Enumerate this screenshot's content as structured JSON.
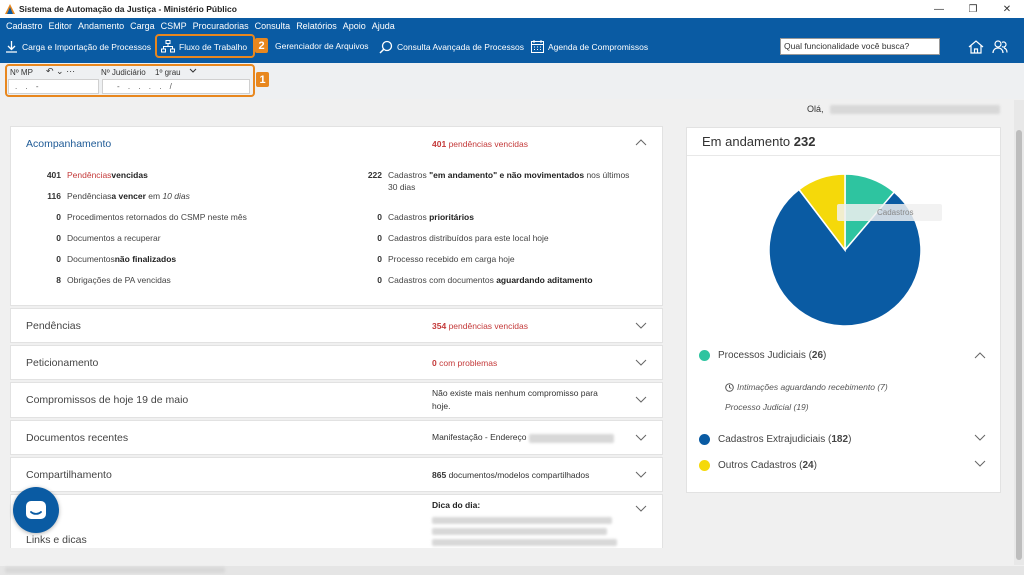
{
  "window": {
    "title": "Sistema de Automação da Justiça - Ministério Público"
  },
  "menu": [
    "Cadastro",
    "Editor",
    "Andamento",
    "Carga",
    "CSMP",
    "Procuradorias",
    "Consulta",
    "Relatórios",
    "Apoio",
    "Ajuda"
  ],
  "toolbar": {
    "carga": "Carga e Importação de Processos",
    "fluxo": "Fluxo de Trabalho",
    "gerenciador": "Gerenciador de Arquivos",
    "consulta": "Consulta Avançada de Processos",
    "agenda": "Agenda de Compromissos",
    "search_placeholder": "Qual funcionalidade você busca?"
  },
  "badges": {
    "one": "1",
    "two": "2"
  },
  "process": {
    "mp_label": "Nº MP",
    "undo_label": "↶ ⌄ ···",
    "jud_label": "Nº Judiciário",
    "grau": "1º grau",
    "mp_value": ".  .  -",
    "jud_value": "- .  .  .  . /"
  },
  "greeting": "Olá,",
  "acompanhamento": {
    "title": "Acompanhamento",
    "status_count": "401",
    "status_text": "pendências vencidas",
    "left": [
      {
        "n": "401",
        "a": "Pendências ",
        "b": "vencidas",
        "c": ""
      },
      {
        "n": "116",
        "a": "Pendências ",
        "b": "a vencer",
        "c": " em ",
        "d": "10 dias"
      },
      {
        "n": "0",
        "a": "Procedimentos retornados do CSMP neste mês",
        "b": "",
        "c": ""
      },
      {
        "n": "0",
        "a": "Documentos a recuperar",
        "b": "",
        "c": ""
      },
      {
        "n": "0",
        "a": "Documentos ",
        "b": "não finalizados",
        "c": ""
      },
      {
        "n": "8",
        "a": "Obrigações de PA vencidas",
        "b": "",
        "c": ""
      }
    ],
    "right": [
      {
        "n": "222",
        "a": "Cadastros ",
        "b": "\"em andamento\" e não movimentados",
        "c": " nos últimos",
        "d": "30 dias"
      },
      {
        "n": "0",
        "a": "Cadastros ",
        "b": "prioritários",
        "c": ""
      },
      {
        "n": "0",
        "a": "Cadastros distribuídos para este local hoje",
        "b": "",
        "c": ""
      },
      {
        "n": "0",
        "a": "Processo recebido em carga hoje",
        "b": "",
        "c": ""
      },
      {
        "n": "0",
        "a": "Cadastros com documentos ",
        "b": "aguardando aditamento",
        "c": ""
      }
    ]
  },
  "sections": [
    {
      "title": "Pendências",
      "count": "354",
      "status": "pendências vencidas",
      "status2": ""
    },
    {
      "title": "Peticionamento",
      "count": "0",
      "status": "com problemas",
      "status2": ""
    },
    {
      "title": "Compromissos de hoje 19 de maio",
      "count": "",
      "status": "Não existe mais nenhum compromisso para",
      "status2": "hoje."
    },
    {
      "title": "Documentos recentes",
      "count": "",
      "status": "Manifestação - Endereço",
      "status2": ""
    },
    {
      "title": "Compartilhamento",
      "count": "865",
      "status": "documentos/modelos compartilhados",
      "status2": ""
    },
    {
      "title": "Links e dicas",
      "count": "",
      "status": "Dica do dia:",
      "status2": ""
    }
  ],
  "side": {
    "title": "Em andamento",
    "total": "232",
    "legend": [
      {
        "label": "Processos Judiciais",
        "count": "26",
        "color": "#2ec4a0"
      },
      {
        "label": "Cadastros Extrajudiciais",
        "count": "182",
        "color": "#0a5ba3"
      },
      {
        "label": "Outros Cadastros",
        "count": "24",
        "color": "#f5d90a"
      }
    ],
    "sub1": "Intimações aguardando recebimento (7)",
    "sub2": "Processo Judicial (19)",
    "tooltip": "Cadastros"
  },
  "chart_data": {
    "type": "pie",
    "categories": [
      "Processos Judiciais",
      "Cadastros Extrajudiciais",
      "Outros Cadastros"
    ],
    "values": [
      26,
      182,
      24
    ],
    "colors": [
      "#2ec4a0",
      "#0a5ba3",
      "#f5d90a"
    ],
    "title": "Em andamento 232"
  }
}
